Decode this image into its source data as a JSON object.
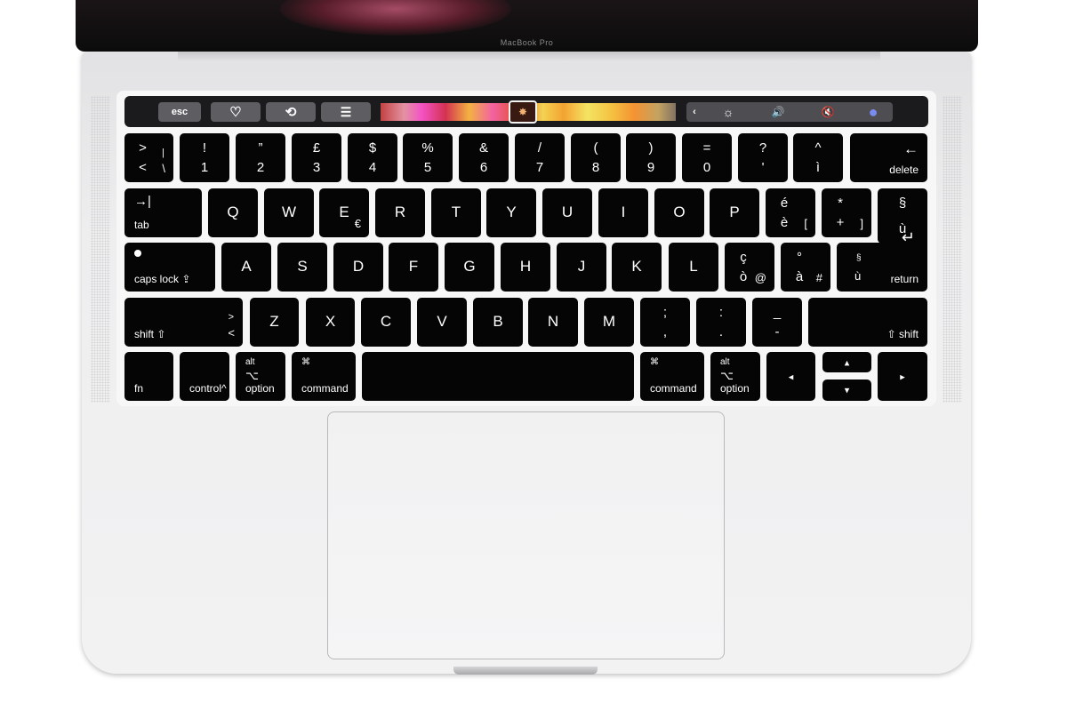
{
  "screen": {
    "brand": "MacBook Pro"
  },
  "touch_bar": {
    "esc": "esc",
    "buttons": [
      {
        "name": "heart-icon",
        "glyph": "♡"
      },
      {
        "name": "rotate-icon",
        "glyph": "⟲"
      },
      {
        "name": "sliders-icon",
        "glyph": "☰"
      }
    ],
    "selected_thumb_glyph": "✸",
    "controls": [
      {
        "name": "chevron-left-icon",
        "glyph": "‹"
      },
      {
        "name": "brightness-icon",
        "glyph": "☼"
      },
      {
        "name": "volume-icon",
        "glyph": "🔊"
      },
      {
        "name": "mute-icon",
        "glyph": "🔇"
      },
      {
        "name": "siri-icon",
        "glyph": "●"
      }
    ]
  },
  "keyboard": {
    "rows": [
      [
        {
          "top": ">",
          "bottom": "<",
          "alt_top": "|",
          "alt_bottom": "\\"
        },
        {
          "top": "!",
          "bottom": "1"
        },
        {
          "top": "”",
          "bottom": "2"
        },
        {
          "top": "£",
          "bottom": "3"
        },
        {
          "top": "$",
          "bottom": "4"
        },
        {
          "top": "%",
          "bottom": "5"
        },
        {
          "top": "&",
          "bottom": "6"
        },
        {
          "top": "/",
          "bottom": "7"
        },
        {
          "top": "(",
          "bottom": "8"
        },
        {
          "top": ")",
          "bottom": "9"
        },
        {
          "top": "=",
          "bottom": "0"
        },
        {
          "top": "?",
          "bottom": "'"
        },
        {
          "top": "^",
          "bottom": "ì"
        },
        {
          "icon": "←",
          "label_r": "delete"
        }
      ],
      [
        {
          "icon_l": "→|",
          "label": "tab"
        },
        {
          "main": "Q"
        },
        {
          "main": "W"
        },
        {
          "main": "E",
          "alt_bottom": "€"
        },
        {
          "main": "R"
        },
        {
          "main": "T"
        },
        {
          "main": "Y"
        },
        {
          "main": "U"
        },
        {
          "main": "I"
        },
        {
          "main": "O"
        },
        {
          "main": "P"
        },
        {
          "top": "é",
          "bottom": "è",
          "alt_bottom": "["
        },
        {
          "top": "*",
          "bottom": "+",
          "alt_bottom": "]"
        },
        {
          "top": "§",
          "bottom": "ù",
          "return_icon": "↵"
        }
      ],
      [
        {
          "indicator": true,
          "label": "caps lock ⇪"
        },
        {
          "main": "A"
        },
        {
          "main": "S"
        },
        {
          "main": "D"
        },
        {
          "main": "F"
        },
        {
          "main": "G"
        },
        {
          "main": "H"
        },
        {
          "main": "J"
        },
        {
          "main": "K"
        },
        {
          "main": "L"
        },
        {
          "top": "ç",
          "bottom": "ò",
          "alt_bottom": "@"
        },
        {
          "top": "°",
          "bottom": "à",
          "alt_bottom": "#"
        },
        {
          "small_top": "§",
          "small_bottom": "ù",
          "label_r": "return"
        }
      ],
      [
        {
          "label": "shift ⇧",
          "alt_top": ">",
          "alt_bottom": "<"
        },
        {
          "main": "Z"
        },
        {
          "main": "X"
        },
        {
          "main": "C"
        },
        {
          "main": "V"
        },
        {
          "main": "B"
        },
        {
          "main": "N"
        },
        {
          "main": "M"
        },
        {
          "top": ";",
          "bottom": ","
        },
        {
          "top": ":",
          "bottom": "."
        },
        {
          "top": "_",
          "bottom": "-"
        },
        {
          "label_r": "⇧ shift"
        }
      ],
      [
        {
          "label": "fn"
        },
        {
          "label": "control^"
        },
        {
          "small_top": "alt",
          "small_mid": "⌥",
          "label": "option"
        },
        {
          "small_top": "⌘",
          "label": "command"
        },
        {},
        {
          "small_top": "⌘",
          "label": "command"
        },
        {
          "small_top": "alt",
          "small_mid": "⌥",
          "label": "option"
        },
        {
          "arrow": "◂"
        },
        {
          "arrow": "▴"
        },
        {
          "arrow": "▾"
        },
        {
          "arrow": "▸"
        }
      ]
    ],
    "key_names": [
      [
        "key-less-than",
        "key-1",
        "key-2",
        "key-3",
        "key-4",
        "key-5",
        "key-6",
        "key-7",
        "key-8",
        "key-9",
        "key-0",
        "key-apostrophe",
        "key-i-grave",
        "key-delete"
      ],
      [
        "key-tab",
        "key-q",
        "key-w",
        "key-e",
        "key-r",
        "key-t",
        "key-y",
        "key-u",
        "key-i",
        "key-o",
        "key-p",
        "key-e-grave",
        "key-plus",
        "key-return-top"
      ],
      [
        "key-caps-lock",
        "key-a",
        "key-s",
        "key-d",
        "key-f",
        "key-g",
        "key-h",
        "key-j",
        "key-k",
        "key-l",
        "key-o-grave",
        "key-a-grave",
        "key-return"
      ],
      [
        "key-left-shift",
        "key-z",
        "key-x",
        "key-c",
        "key-v",
        "key-b",
        "key-n",
        "key-m",
        "key-comma",
        "key-period",
        "key-minus",
        "key-right-shift"
      ],
      [
        "key-fn",
        "key-control",
        "key-left-option",
        "key-left-command",
        "key-space",
        "key-right-command",
        "key-right-option",
        "key-arrow-left",
        "key-arrow-up",
        "key-arrow-down",
        "key-arrow-right"
      ]
    ]
  }
}
